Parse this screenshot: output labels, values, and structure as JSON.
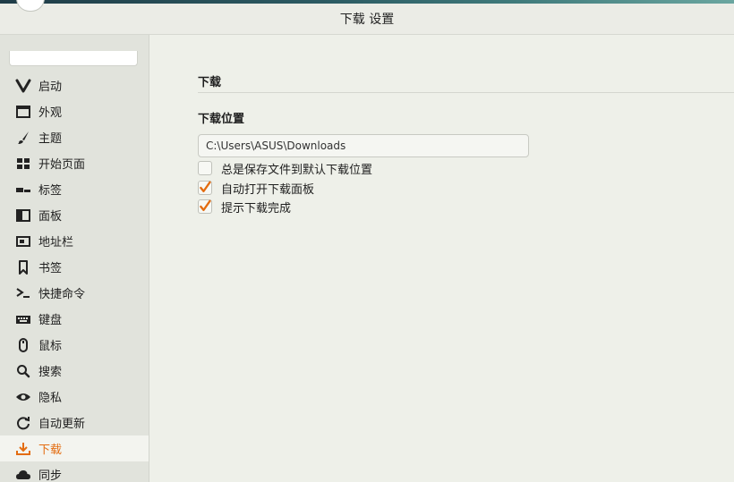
{
  "window": {
    "title": "下载 设置"
  },
  "sidebar": {
    "items": [
      {
        "label": "启动",
        "icon": "vivaldi-icon"
      },
      {
        "label": "外观",
        "icon": "window-icon"
      },
      {
        "label": "主题",
        "icon": "brush-icon"
      },
      {
        "label": "开始页面",
        "icon": "grid-icon"
      },
      {
        "label": "标签",
        "icon": "tabs-icon"
      },
      {
        "label": "面板",
        "icon": "panel-icon"
      },
      {
        "label": "地址栏",
        "icon": "address-bar-icon"
      },
      {
        "label": "书签",
        "icon": "bookmark-icon"
      },
      {
        "label": "快捷命令",
        "icon": "quick-command-icon"
      },
      {
        "label": "键盘",
        "icon": "keyboard-icon"
      },
      {
        "label": "鼠标",
        "icon": "mouse-icon"
      },
      {
        "label": "搜索",
        "icon": "search-icon"
      },
      {
        "label": "隐私",
        "icon": "eye-icon"
      },
      {
        "label": "自动更新",
        "icon": "refresh-icon"
      },
      {
        "label": "下载",
        "icon": "download-icon",
        "active": true
      },
      {
        "label": "同步",
        "icon": "cloud-icon"
      }
    ],
    "active_color": "#e36c10"
  },
  "content": {
    "section_title": "下载",
    "location_title": "下载位置",
    "location_value": "C:\\Users\\ASUS\\Downloads",
    "options": [
      {
        "label": "总是保存文件到默认下载位置",
        "checked": false
      },
      {
        "label": "自动打开下载面板",
        "checked": true
      },
      {
        "label": "提示下载完成",
        "checked": true
      }
    ],
    "check_color": "#e36c10"
  }
}
